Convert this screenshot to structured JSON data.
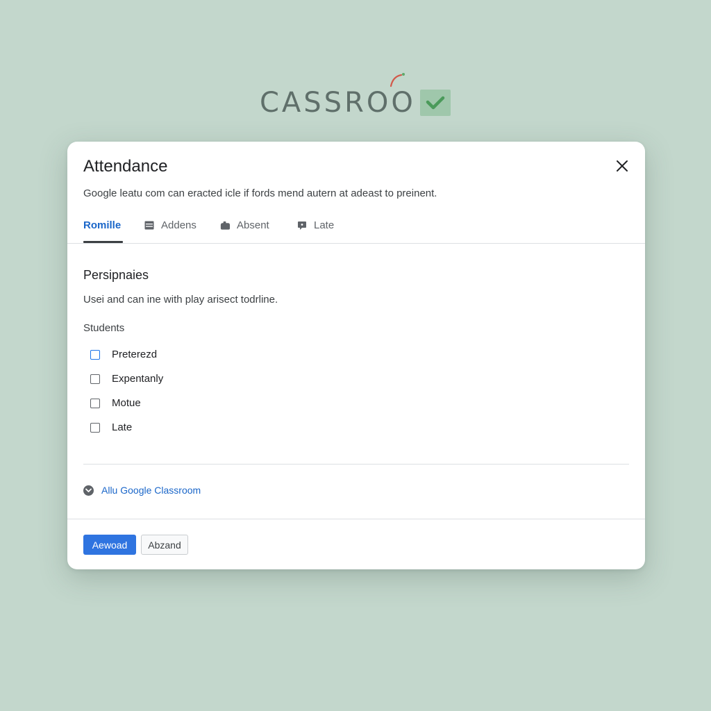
{
  "logo": {
    "text": "CASSROO"
  },
  "dialog": {
    "title": "Attendance",
    "subtitle": "Google leatu com can eracted icle if fords mend autern at adeast to preinent.",
    "close_icon": "close-icon"
  },
  "tabs": [
    {
      "label": "Romille",
      "icon": "",
      "active": true
    },
    {
      "label": "Addens",
      "icon": "list-icon",
      "active": false
    },
    {
      "label": "Absent",
      "icon": "hand-icon",
      "active": false
    },
    {
      "label": "Late",
      "icon": "comment-icon",
      "active": false
    }
  ],
  "section": {
    "title": "Persipnaies",
    "description": "Usei and can ine with play arisect todrline."
  },
  "students": {
    "label": "Students",
    "options": [
      {
        "label": "Preterezd",
        "checked": false
      },
      {
        "label": "Expentanly",
        "checked": false
      },
      {
        "label": "Motue",
        "checked": false
      },
      {
        "label": "Late",
        "checked": false
      }
    ]
  },
  "link": {
    "label": "Allu Google Classroom",
    "icon": "chevron-down-circle-icon"
  },
  "footer": {
    "primary_label": "Aewoad",
    "secondary_label": "Abzand"
  },
  "colors": {
    "background": "#c3d7cc",
    "accent": "#1a66c9",
    "primary_button": "#2f74e0",
    "logo_check": "#5fa86a"
  }
}
